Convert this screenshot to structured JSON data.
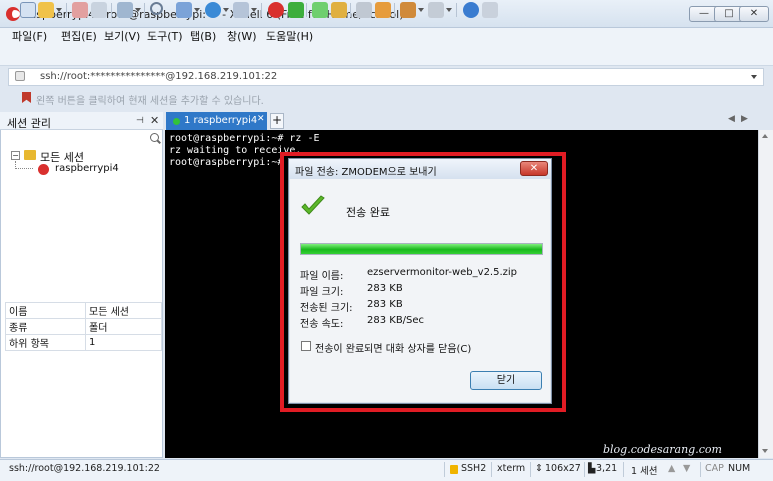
{
  "window": {
    "title": "raspberrypi4 - root@raspberrypi: ~ - Xshell 6 (Free for Home/School)",
    "minimize": "—",
    "maximize": "□",
    "close": "✕"
  },
  "menu": [
    "파일(F)",
    "편집(E)",
    "보기(V)",
    "도구(T)",
    "탭(B)",
    "창(W)",
    "도움말(H)"
  ],
  "address": {
    "text": "ssh://root:***************@192.168.219.101:22"
  },
  "hint": "왼쪽 버튼을 클릭하여 현재 세션을 추가할 수 있습니다.",
  "session_panel": {
    "title": "세션 관리",
    "pin": "⊣",
    "close": "✕",
    "tree_root": "모든 세션",
    "tree_child": "raspberrypi4",
    "properties": [
      [
        "이름",
        "모든 세션"
      ],
      [
        "종류",
        "폴더"
      ],
      [
        "하위 항목",
        "1"
      ]
    ]
  },
  "tabs": {
    "active_number": "1",
    "active_label": "1 raspberrypi4",
    "close": "✕",
    "new": "+",
    "prev": "◀",
    "next": "▶"
  },
  "terminal": {
    "lines": [
      "root@raspberrypi:~# rz -E",
      "rz waiting to receive.",
      "root@raspberrypi:~# "
    ]
  },
  "dialog": {
    "title": "파일 전송: ZMODEM으로 보내기",
    "close": "✕",
    "status": "전송 완료",
    "progress": 1.0,
    "file_name_label": "파일 이름:",
    "file_name": "ezservermonitor-web_v2.5.zip",
    "file_size_label": "파일 크기:",
    "file_size": "283 KB",
    "transferred_label": "전송된 크기:",
    "transferred": "283 KB",
    "speed_label": "전송 속도:",
    "speed": "283 KB/Sec",
    "auto_close_label": "전송이 완료되면 대화 상자를 닫음(C)",
    "close_button": "닫기"
  },
  "watermark": "blog.codesarang.com",
  "status": {
    "connection": "ssh://root@192.168.219.101:22",
    "protocol": "SSH2",
    "terminal_type": "xterm",
    "size": "106x27",
    "cursor": "3,21",
    "sessions": "1 세션",
    "caps": "CAP",
    "num": "NUM"
  },
  "colors": {
    "accent_tab": "#2f78c8",
    "highlight": "#e11c24",
    "progress": "#19b81c"
  }
}
